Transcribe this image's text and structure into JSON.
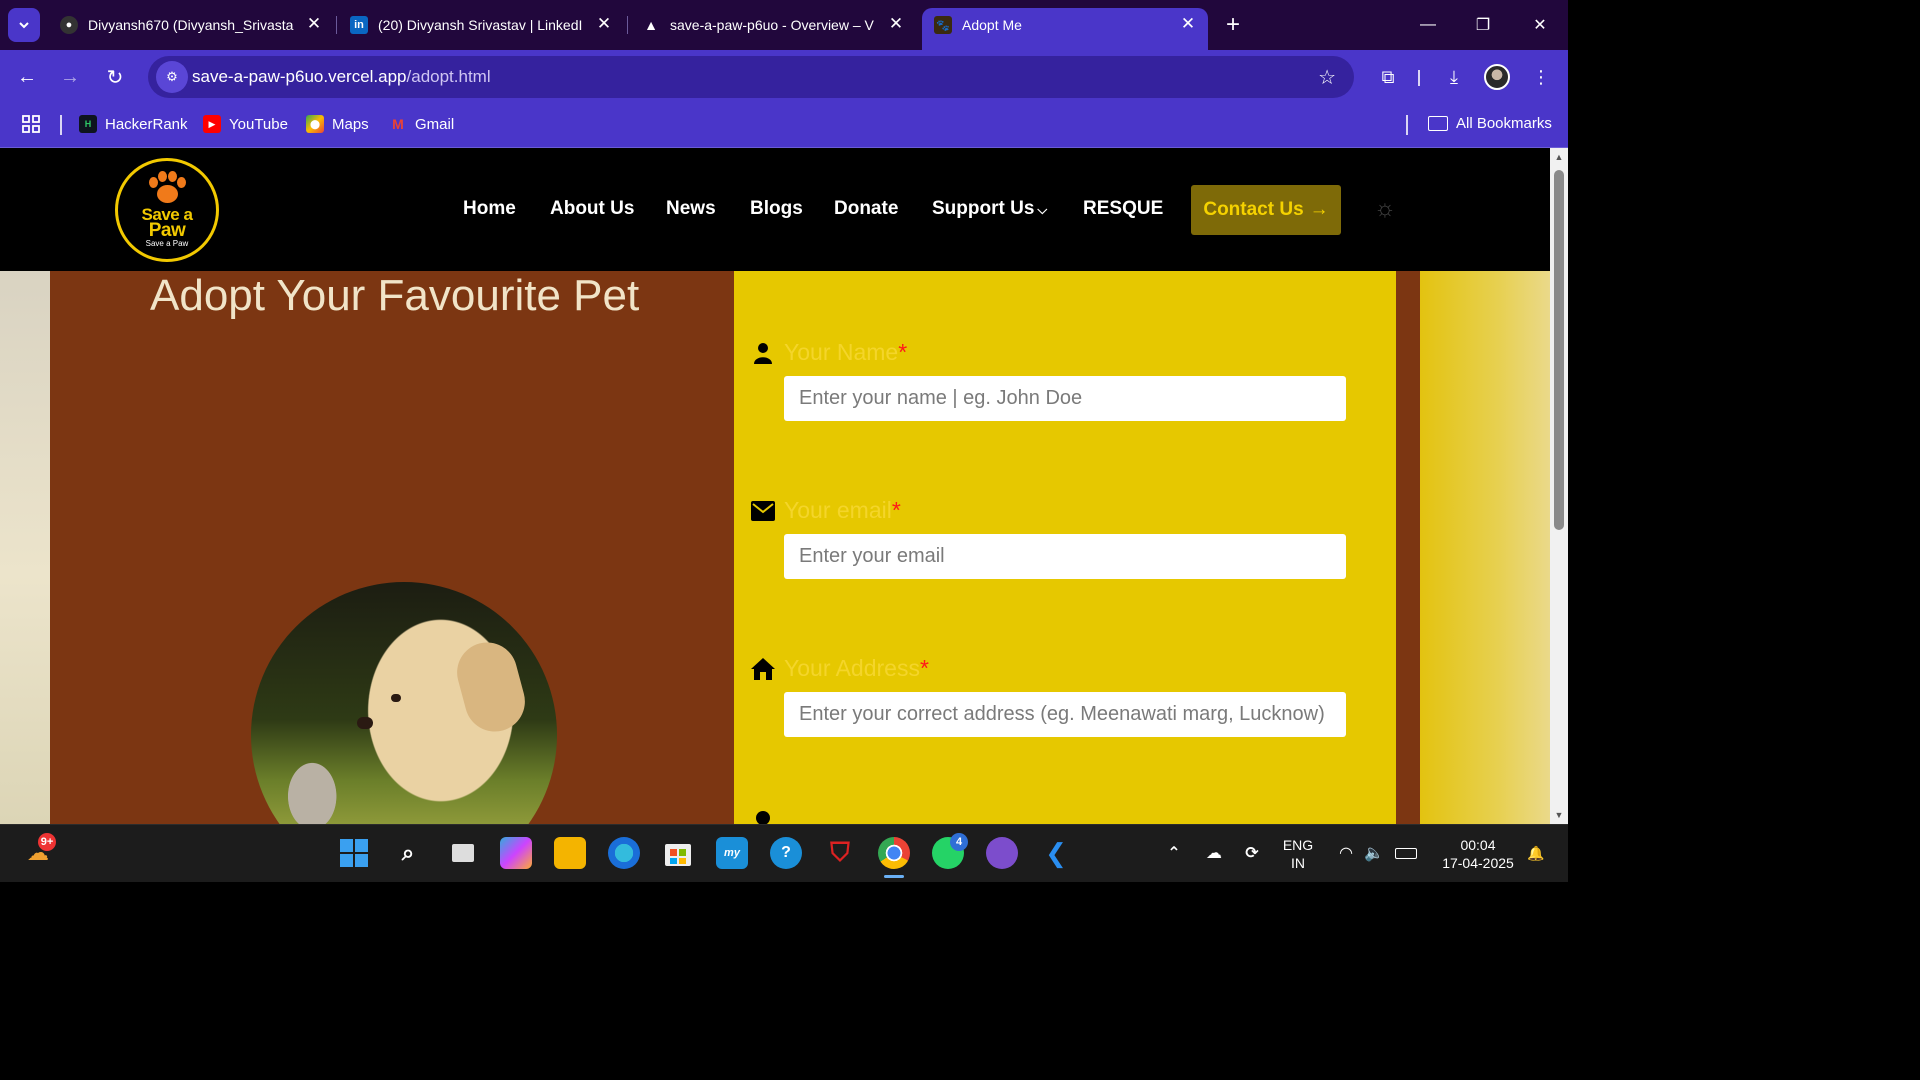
{
  "browser": {
    "tabs": [
      {
        "title": "Divyansh670 (Divyansh_Srivasta",
        "favicon": "github-icon",
        "active": false
      },
      {
        "title": "(20) Divyansh Srivastav | LinkedI",
        "favicon": "linkedin-icon",
        "active": false
      },
      {
        "title": "save-a-paw-p6uo - Overview – V",
        "favicon": "vercel-icon",
        "active": false
      },
      {
        "title": "Adopt Me",
        "favicon": "save-a-paw-icon",
        "active": true
      }
    ],
    "url_host": "save-a-paw-p6uo.vercel.app",
    "url_path": "/adopt.html",
    "bookmarks": [
      {
        "label": "HackerRank",
        "icon": "hackerrank-icon"
      },
      {
        "label": "YouTube",
        "icon": "youtube-icon"
      },
      {
        "label": "Maps",
        "icon": "maps-icon"
      },
      {
        "label": "Gmail",
        "icon": "gmail-icon"
      }
    ],
    "all_bookmarks": "All Bookmarks",
    "accent": "#4a36c9"
  },
  "site": {
    "logo_line1": "Save a",
    "logo_line2": "Paw",
    "logo_tagline": "Save a Paw",
    "nav": [
      "Home",
      "About Us",
      "News",
      "Blogs",
      "Donate",
      "Support Us",
      "RESQUE"
    ],
    "contact_label": "Contact Us",
    "page_title": "Adopt Your Favourite Pet",
    "form": {
      "name_label": "Your Name",
      "name_placeholder": "Enter your name | eg. John Doe",
      "email_label": "Your email",
      "email_placeholder": "Enter your email",
      "address_label": "Your Address",
      "address_placeholder": "Enter your correct address (eg. Meenawati marg, Lucknow)",
      "required_mark": "*"
    },
    "colors": {
      "panel_brown": "#7c3612",
      "form_yellow": "#e6c800",
      "label_yellow": "#f4d52a",
      "required_red": "#ff1a1a"
    }
  },
  "taskbar": {
    "weather_badge": "9+",
    "whatsapp_badge": "4",
    "lang_line1": "ENG",
    "lang_line2": "IN",
    "time": "00:04",
    "date": "17-04-2025"
  }
}
